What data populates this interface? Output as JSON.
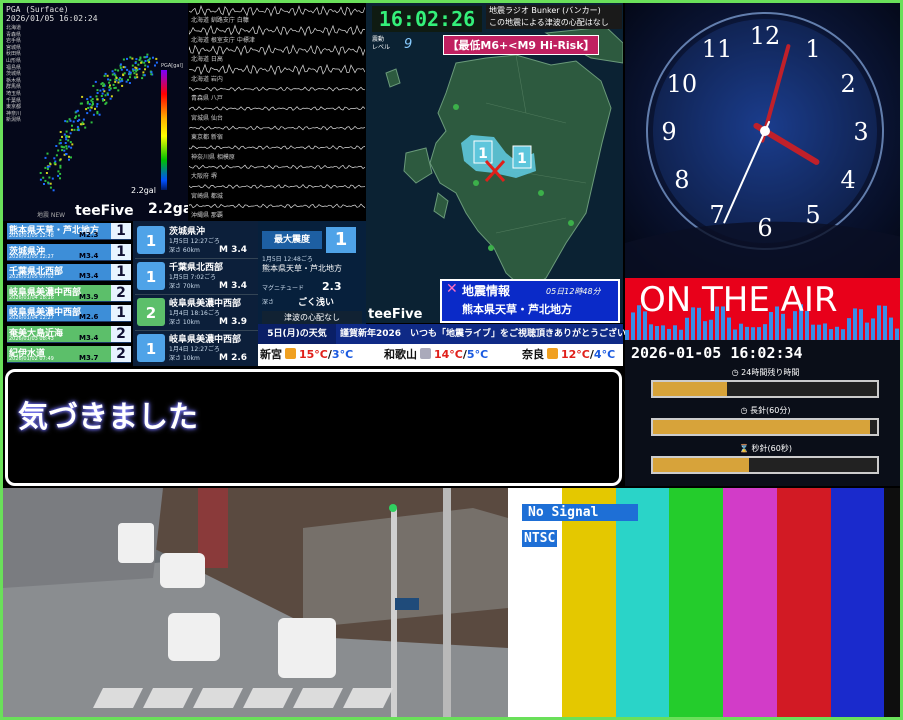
{
  "pga": {
    "header_line1": "PGA (Surface)",
    "header_line2": "2026/01/05 16:02:24",
    "legend_items": [
      "北海道",
      "青森県",
      "岩手県",
      "宮城県",
      "秋田県",
      "山形県",
      "福島県",
      "茨城県",
      "栃木県",
      "群馬県",
      "埼玉県",
      "千葉県",
      "東京都",
      "神奈川",
      "新潟県"
    ],
    "scale_title": "PGA[gal]",
    "gal_small": "2.2gal",
    "gal_big": "2.2gal",
    "maker_small": "地震 NEW",
    "maker": "teeFive"
  },
  "seismograph": {
    "stations": [
      "北海道 釧路支庁 白糠",
      "北海道 根室支庁 中標津",
      "北海道 日高",
      "北海道 岩内",
      "青森県 八戸",
      "宮城県 仙台",
      "東京都 新宿",
      "神奈川県 相模原",
      "大阪府 堺",
      "宮崎県 都城",
      "沖縄県 那覇"
    ]
  },
  "kyushu": {
    "clock": "16:02:26",
    "bunker_title": "地震ラジオ Bunker (バンカー)",
    "bunker_msg": "この地震による津波の心配はなし",
    "shindo_label": "震動\nレベル",
    "shindo_level": "9",
    "risk": "【最低M6+<M9 Hi-Risk】",
    "maker": "teeFive",
    "map_badges": [
      "1",
      "1",
      "1"
    ]
  },
  "eq_info": {
    "title": "地震情報",
    "datetime": "05日12時48分",
    "location": "熊本県天草・芦北地方"
  },
  "quake_list": [
    {
      "name": "熊本県天草・芦北地方",
      "date": "2026/01/05 12:48",
      "mag": "M2.3",
      "shindo": "1",
      "type": "low"
    },
    {
      "name": "茨城県沖",
      "date": "2026/01/05 12:27",
      "mag": "M3.4",
      "shindo": "1",
      "type": "low"
    },
    {
      "name": "千葉県北西部",
      "date": "2026/01/05 07:02",
      "mag": "M3.4",
      "shindo": "1",
      "type": "low"
    },
    {
      "name": "岐阜県美濃中西部",
      "date": "2026/01/04 18:16",
      "mag": "M3.9",
      "shindo": "2",
      "type": "mid"
    },
    {
      "name": "岐阜県美濃中西部",
      "date": "2026/01/04 12:27",
      "mag": "M2.6",
      "shindo": "1",
      "type": "low"
    },
    {
      "name": "奄美大島近海",
      "date": "2026/01/03 08:43",
      "mag": "M3.4",
      "shindo": "2",
      "type": "mid"
    },
    {
      "name": "紀伊水道",
      "date": "2026/01/02 07:49",
      "mag": "M3.7",
      "shindo": "2",
      "type": "mid"
    }
  ],
  "quake_detail": [
    {
      "name": "茨城県沖",
      "time": "1月5日 12:27ごろ",
      "depth": "深さ 60km",
      "mag": "M 3.4",
      "shindo": "1",
      "type": "low"
    },
    {
      "name": "千葉県北西部",
      "time": "1月5日 7:02ごろ",
      "depth": "深さ 70km",
      "mag": "M 3.4",
      "shindo": "1",
      "type": "low"
    },
    {
      "name": "岐阜県美濃中西部",
      "time": "1月4日 18:16ごろ",
      "depth": "深さ 10km",
      "mag": "M 3.9",
      "shindo": "2",
      "type": "mid"
    },
    {
      "name": "岐阜県美濃中西部",
      "time": "1月4日 12:27ごろ",
      "depth": "深さ 10km",
      "mag": "M 2.6",
      "shindo": "1",
      "type": "low"
    }
  ],
  "max_shindo": {
    "label": "最大震度",
    "value": "1",
    "time": "1月5日 12:48ごろ",
    "location": "熊本県天草・芦北地方",
    "mag_label": "マグニチュード",
    "mag_value": "2.3",
    "depth_label": "深さ",
    "depth_value": "ごく浅い",
    "tsunami": "津波の心配なし"
  },
  "weather": {
    "day": "5日(月)の天気",
    "message": "謹賀新年2026　いつも「地震ライブ」をご視聴頂きありがとうございます!",
    "cities": [
      {
        "city": "新宮",
        "hi": "15°C",
        "lo": "3°C",
        "icon": "sun-cloud-icon"
      },
      {
        "city": "和歌山",
        "hi": "14°C",
        "lo": "5°C",
        "icon": "cloud-icon"
      },
      {
        "city": "奈良",
        "hi": "12°C",
        "lo": "4°C",
        "icon": "sun-cloud-icon"
      }
    ]
  },
  "message_box": {
    "text": "気づきました"
  },
  "clock": {
    "numerals": [
      "12",
      "1",
      "2",
      "3",
      "4",
      "5",
      "6",
      "7",
      "8",
      "9",
      "10",
      "11"
    ],
    "hour": 16,
    "minute": 2,
    "second": 34
  },
  "onair": {
    "text": "ON THE AIR"
  },
  "timers": {
    "datetime": "2026-01-05 16:02:34",
    "items": [
      {
        "label": "24時間残り時間",
        "icon": "clock-icon",
        "progress": 0.33
      },
      {
        "label": "長針(60分)",
        "icon": "clock-icon",
        "progress": 0.97
      },
      {
        "label": "秒針(60秒)",
        "icon": "hourglass-icon",
        "progress": 0.43
      }
    ]
  },
  "colorbars": {
    "no_signal": "No Signal",
    "ntsc": "NTSC",
    "colors": [
      "#ffffff",
      "#e4c800",
      "#2ad4c8",
      "#24cc2c",
      "#d23cc8",
      "#d21a24",
      "#1a2acc",
      "#0e0e0e"
    ]
  }
}
